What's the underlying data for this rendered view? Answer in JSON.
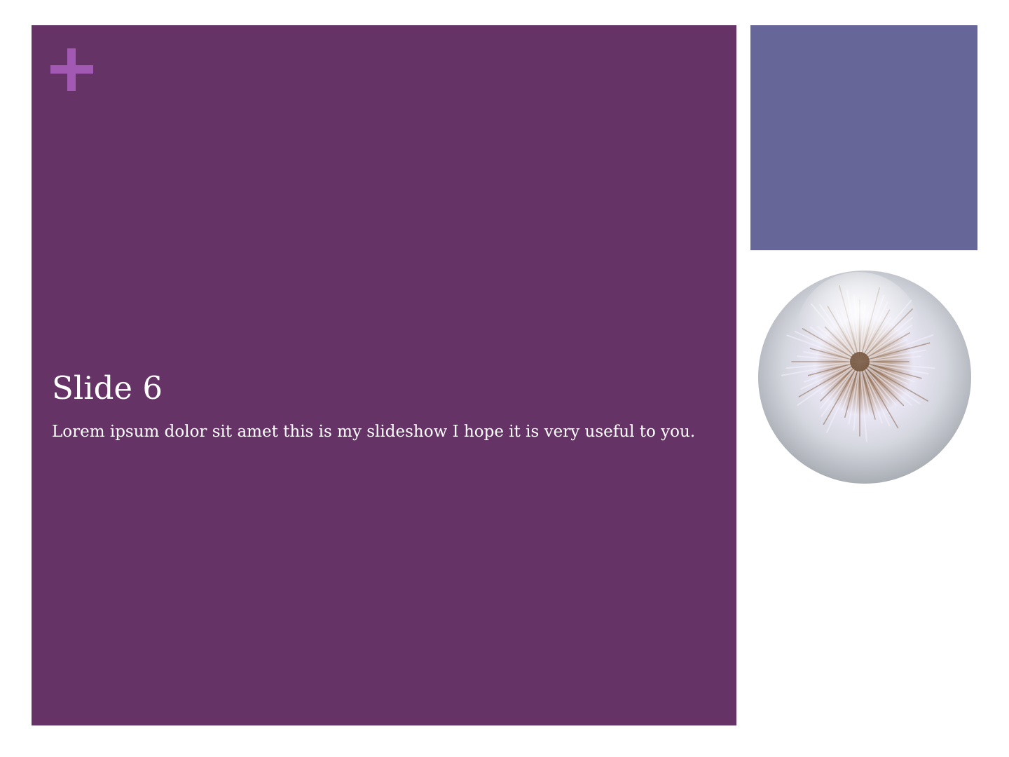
{
  "slide": {
    "title": "Slide 6",
    "body": "Lorem ipsum dolor sit amet this is my slideshow I hope it is very useful to you."
  },
  "colors": {
    "panel": "#663366",
    "accent_block": "#666699",
    "plus_mark": "#a159b4",
    "text": "#ffffff",
    "background": "#ffffff"
  },
  "icons": {
    "plus": "plus-icon",
    "image": "dandelion-puff-photo"
  }
}
